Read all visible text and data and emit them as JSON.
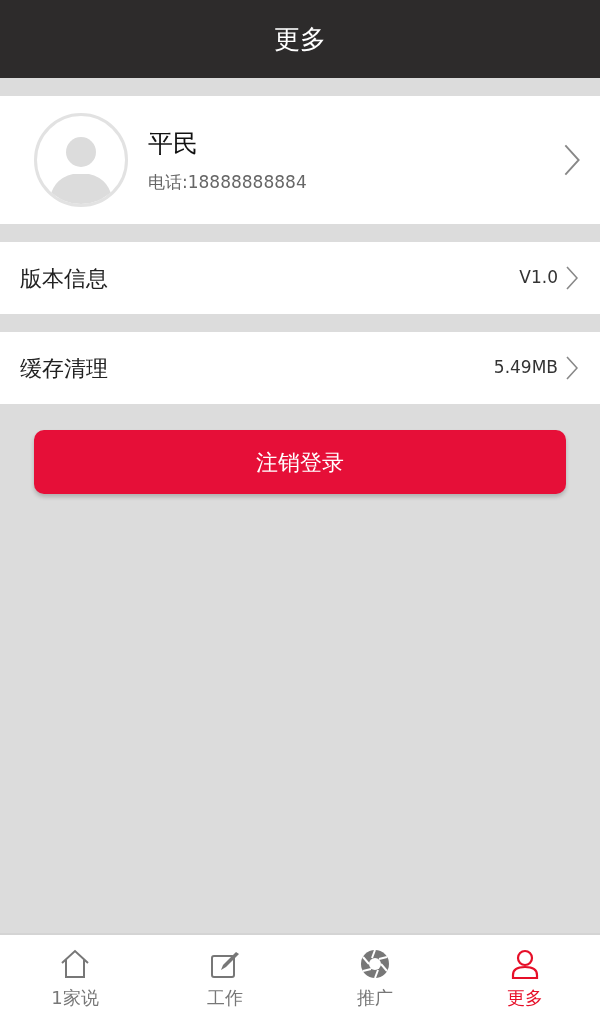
{
  "header": {
    "title": "更多"
  },
  "profile": {
    "name": "平民",
    "phone": "电话:18888888884"
  },
  "settings": [
    {
      "label": "版本信息",
      "value": "V1.0"
    },
    {
      "label": "缓存清理",
      "value": "5.49MB"
    }
  ],
  "logout_button": "注销登录",
  "tab_bar": [
    {
      "label": "1家说",
      "selected": false
    },
    {
      "label": "工作",
      "selected": false
    },
    {
      "label": "推广",
      "selected": false
    },
    {
      "label": "更多",
      "selected": true
    }
  ]
}
